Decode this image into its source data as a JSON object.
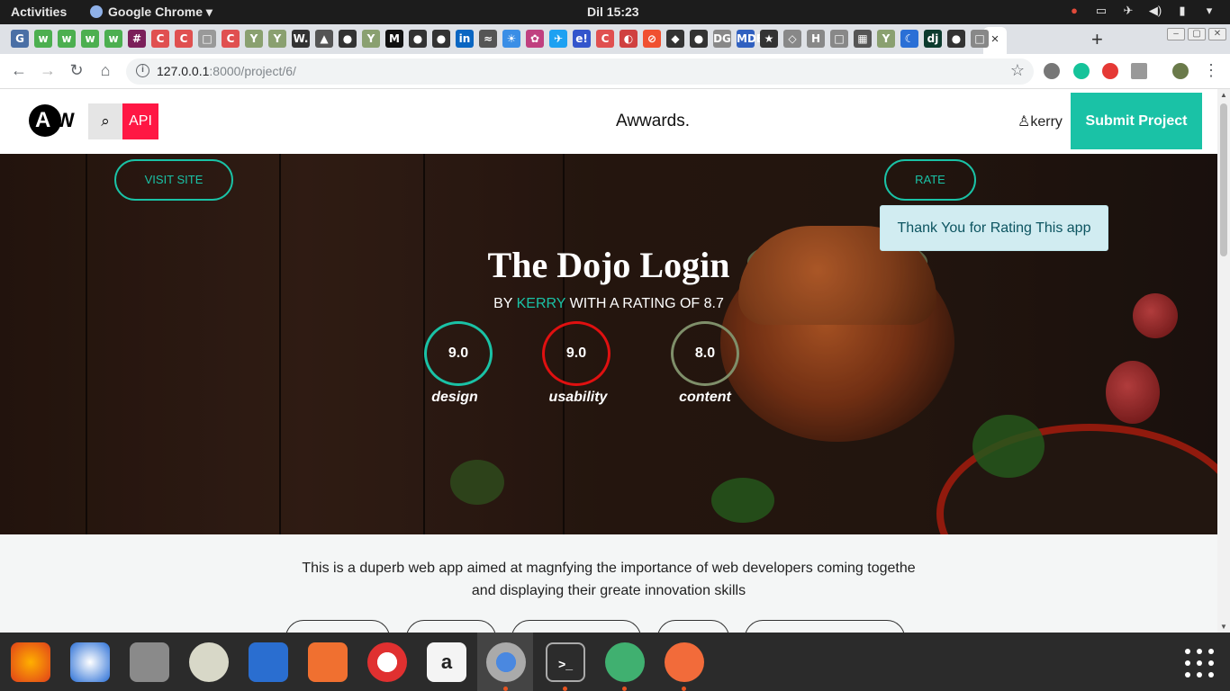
{
  "system_bar": {
    "activities": "Activities",
    "app_name": "Google Chrome",
    "clock": "Dil 15:23",
    "tray_icons": [
      "chrome-icon",
      "screen-icon",
      "airplane-icon",
      "volume-icon",
      "battery-icon",
      "power-menu-icon"
    ]
  },
  "browser": {
    "new_tab": "+",
    "close_tab": "×",
    "url_host": "127.0.0.1",
    "url_path": ":8000/project/6/",
    "tab_favicons": [
      "G",
      "w",
      "w",
      "w",
      "w",
      "#",
      "C",
      "C",
      "□",
      "C",
      "Y",
      "Y",
      "W.",
      "▲",
      "●",
      "Y",
      "M",
      "●",
      "●",
      "in",
      "≈",
      "☀",
      "✿",
      "✈",
      "e!",
      "C",
      "◐",
      "⊘",
      "◆",
      "●",
      "DG",
      "MDB",
      "★",
      "◇",
      "H",
      "□",
      "▦",
      "Y",
      "☾",
      "dj",
      "●",
      "□"
    ]
  },
  "site": {
    "logo_letter": "A",
    "logo_letter2": "W",
    "search_icon": "⌕",
    "api_label": "API",
    "brand": "Awwards.",
    "user_icon": "♙",
    "username": "kerry",
    "submit_label": "Submit Project"
  },
  "project": {
    "visit_label": "VISIT SITE",
    "rate_label": "RATE",
    "alert_text": "Thank You for Rating This app",
    "title": "The Dojo Login",
    "by_prefix": "BY ",
    "author": "KERRY",
    "rating_prefix": " WITH A RATING OF ",
    "rating": "8.7",
    "scores": [
      {
        "value": "9.0",
        "label": "design",
        "color": "#1ac2a6"
      },
      {
        "value": "9.0",
        "label": "usability",
        "color": "#e01010"
      },
      {
        "value": "8.0",
        "label": "content",
        "color": "#7f8f6a"
      }
    ],
    "description_line1": "This is a duperb web app aimed at magnfying the importance of web developers coming togethe",
    "description_line2": "and displaying their greate innovation skills"
  },
  "dock": {
    "apps": [
      "firefox-icon",
      "thunderbird-icon",
      "files-icon",
      "rhythmbox-icon",
      "libreoffice-writer-icon",
      "software-center-icon",
      "help-icon",
      "amazon-icon",
      "chrome-icon",
      "terminal-icon",
      "atom-icon",
      "postman-icon"
    ],
    "show_apps": "show-applications-icon"
  }
}
